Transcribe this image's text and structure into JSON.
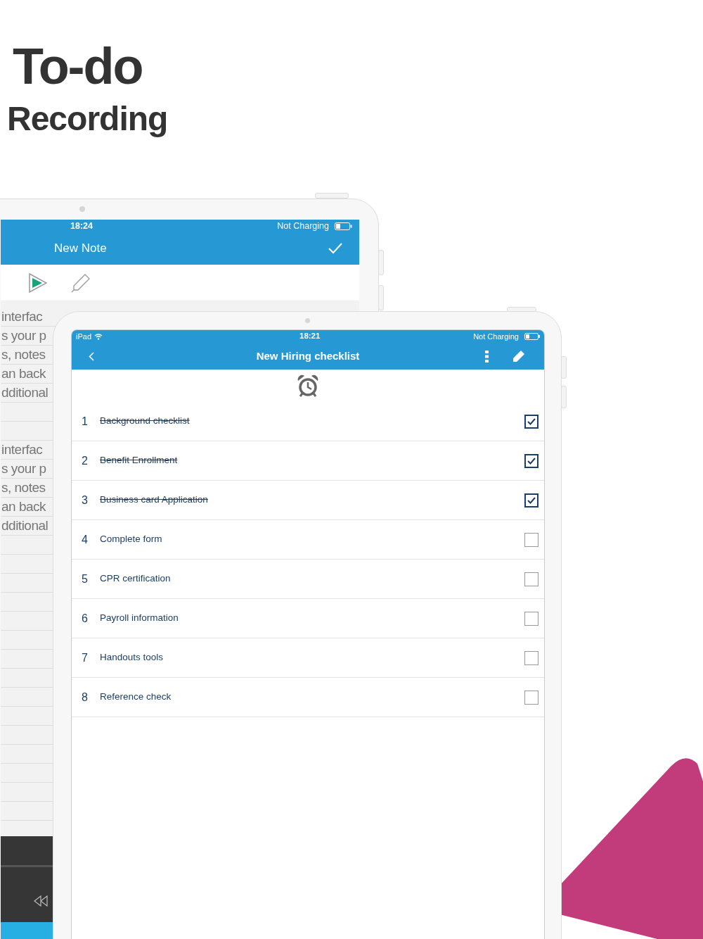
{
  "heading": {
    "title": "To-do",
    "subtitle": "Recording"
  },
  "note_screen": {
    "status_bar": {
      "time": "18:24",
      "battery_text": "Not Charging"
    },
    "title": "New Note",
    "paragraphs": [
      [
        "interfac",
        "s your p",
        "s, notes",
        "an back",
        "dditional"
      ],
      [
        "interfac",
        "s your p",
        "s, notes",
        "an back",
        "dditional"
      ]
    ]
  },
  "checklist_screen": {
    "status_bar": {
      "device": "iPad",
      "time": "18:21",
      "battery_text": "Not Charging"
    },
    "title": "New Hiring checklist",
    "items": [
      {
        "number": "1",
        "text": "Background checklist",
        "checked": true
      },
      {
        "number": "2",
        "text": "Benefit Enrollment",
        "checked": true
      },
      {
        "number": "3",
        "text": "Business card Application",
        "checked": true
      },
      {
        "number": "4",
        "text": "Complete form",
        "checked": false
      },
      {
        "number": "5",
        "text": "CPR certification",
        "checked": false
      },
      {
        "number": "6",
        "text": "Payroll information",
        "checked": false
      },
      {
        "number": "7",
        "text": "Handouts tools",
        "checked": false
      },
      {
        "number": "8",
        "text": "Reference check",
        "checked": false
      }
    ]
  }
}
